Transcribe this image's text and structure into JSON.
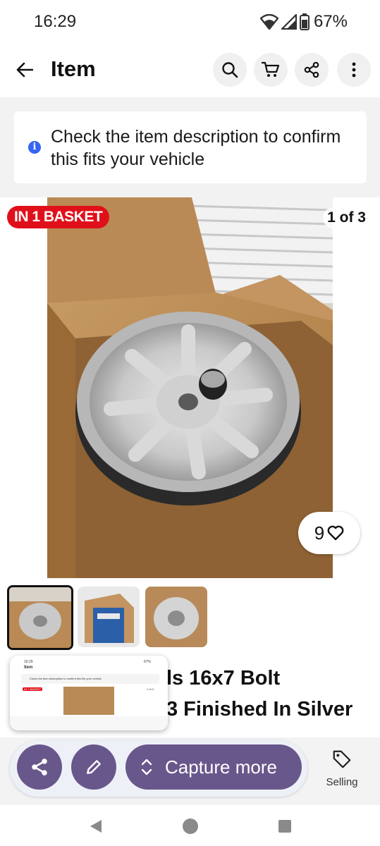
{
  "status_bar": {
    "time": "16:29",
    "battery": "67%"
  },
  "app_bar": {
    "title": "Item"
  },
  "notice": {
    "text": "Check the item description to confirm this fits your vehicle"
  },
  "hero": {
    "badge": "IN 1 BASKET",
    "counter": "1 of 3",
    "watch_count": "9"
  },
  "title": {
    "line1": "ls  16x7 Bolt",
    "line2": "3 Finished In Silver"
  },
  "preview": {
    "time": "16:29",
    "battery": "67%",
    "app_title": "Item",
    "notice": "Check the item description to confirm this fits your vehicle",
    "badge": "IN 1 BASKET",
    "counter": "1 of 3"
  },
  "toolbar": {
    "capture_label": "Capture more",
    "selling_label": "Selling"
  },
  "colors": {
    "accent": "#68578b",
    "badge_red": "#e0101a",
    "info_blue": "#3665f3"
  }
}
